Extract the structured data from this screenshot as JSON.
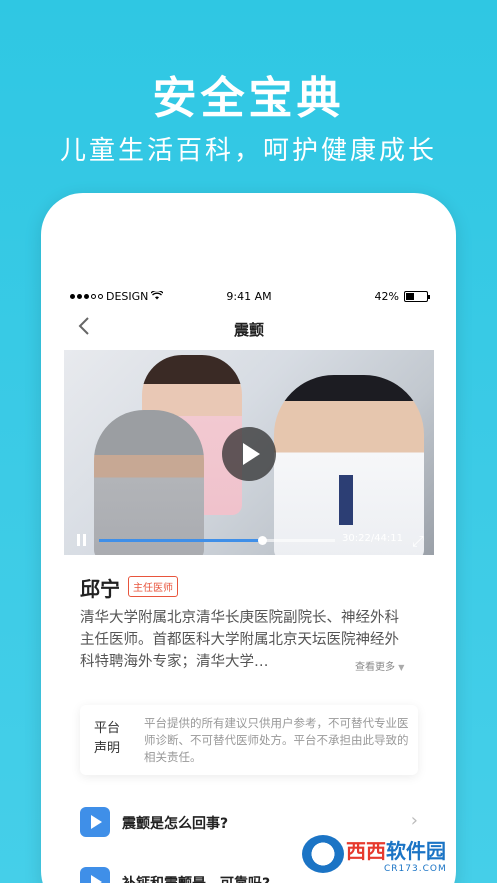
{
  "hero": {
    "title": "安全宝典",
    "subtitle": "儿童生活百科，呵护健康成长"
  },
  "status_bar": {
    "carrier": "DESIGN",
    "time": "9:41 AM",
    "battery": "42%",
    "battery_level": 0.42
  },
  "nav": {
    "back_icon": "chevron-left-icon",
    "title": "震颤"
  },
  "video": {
    "current_time": "30:22",
    "total_time": "44:11",
    "time_display": "30:22/44:11",
    "progress": 0.69
  },
  "doctor": {
    "name": "邱宁",
    "title_badge": "主任医师",
    "bio": "清华大学附属北京清华长庚医院副院长、神经外科主任医师。首都医科大学附属北京天坛医院神经外科特聘海外专家；清华大学…",
    "more_label": "查看更多"
  },
  "disclaimer": {
    "label": "平台声明",
    "text": "平台提供的所有建议只供用户参考，不可替代专业医师诊断、不可替代医师处方。平台不承担由此导致的相关责任。"
  },
  "questions": [
    {
      "label": "震颤是怎么回事?"
    },
    {
      "label": "补钙和震颤是…可靠吗?"
    }
  ],
  "watermark": {
    "brand": "西西",
    "suffix": "软件园",
    "domain": "CR173.COM"
  },
  "colors": {
    "background": "#2fc7e3",
    "accent": "#3f8fe8",
    "badge": "#e8553d"
  }
}
